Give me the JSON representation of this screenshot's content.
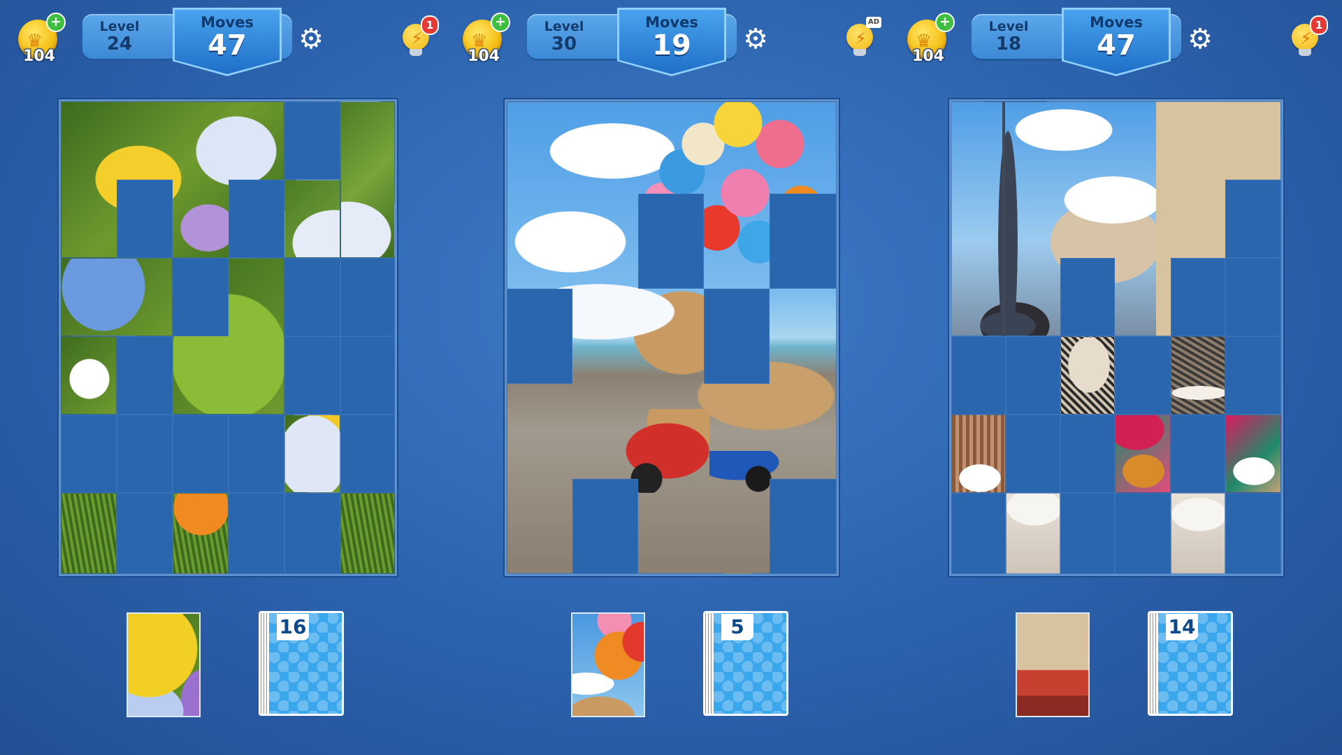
{
  "panels": [
    {
      "coins": "104",
      "level_label": "Level",
      "level": "24",
      "moves_label": "Moves",
      "moves": "47",
      "hint_badge": "1",
      "deck_count": "16",
      "theme": "painted-stones"
    },
    {
      "coins": "104",
      "level_label": "Level",
      "level": "30",
      "moves_label": "Moves",
      "moves": "19",
      "hint_badge": "AD",
      "deck_count": "5",
      "theme": "teddy-beach"
    },
    {
      "coins": "104",
      "level_label": "Level",
      "level": "18",
      "moves_label": "Moves",
      "moves": "47",
      "hint_badge": "1",
      "deck_count": "14",
      "theme": "paris"
    }
  ],
  "icons": {
    "coin": "crown-coin-icon",
    "add": "plus-icon",
    "settings": "gear-icon",
    "hint": "lightbulb-icon"
  },
  "colors": {
    "background": "#2c62ad",
    "empty_slot": "#2a66ae",
    "accent": "#3d89d6",
    "badge_red": "#e53935",
    "badge_green": "#3fbf3f"
  }
}
